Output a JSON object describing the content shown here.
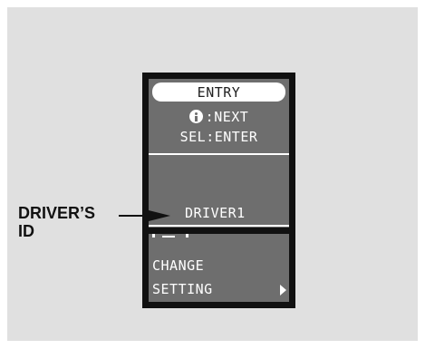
{
  "display": {
    "entry_label": "ENTRY",
    "next_text": ":NEXT",
    "sel_text": "SEL:ENTER",
    "driver_text": "DRIVER1",
    "change_text": "CHANGE",
    "setting_text": "SETTING"
  },
  "callout": {
    "line1": "DRIVER’S",
    "line2": "ID"
  },
  "colors": {
    "panel_background": "#e0e0e0",
    "display_frame": "#111111",
    "lcd_background": "#6e6e6e",
    "lcd_text": "#ffffff"
  },
  "icons": {
    "info": "info-icon",
    "scroll": "arrow-right-icon",
    "callout": "callout-arrow-icon"
  }
}
